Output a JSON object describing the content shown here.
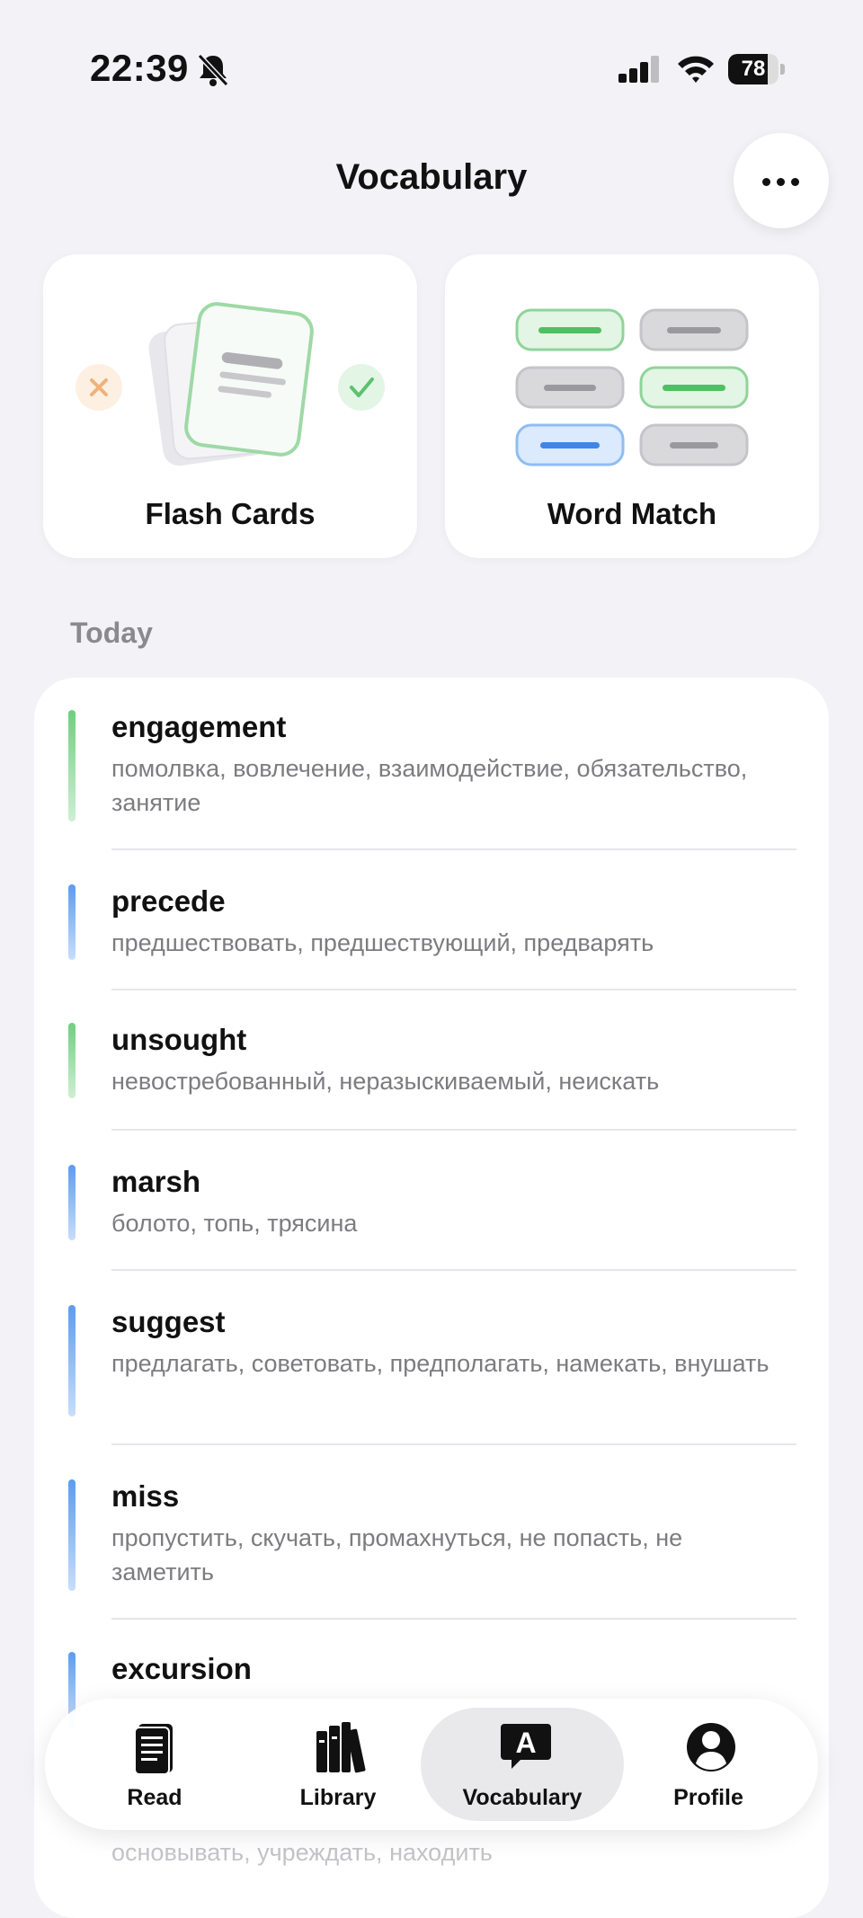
{
  "status_bar": {
    "time": "22:39",
    "battery": "78",
    "battery_level": 0.78
  },
  "header": {
    "title": "Vocabulary"
  },
  "modes": [
    {
      "label": "Flash Cards"
    },
    {
      "label": "Word Match"
    }
  ],
  "section": {
    "label": "Today"
  },
  "words": [
    {
      "word": "engagement",
      "translation": "помолвка, вовлечение, взаимодействие, обязательство, занятие",
      "accent": "#6fcf7f"
    },
    {
      "word": "precede",
      "translation": "предшествовать, предшествующий, предварять",
      "accent": "#5b9cf2"
    },
    {
      "word": "unsought",
      "translation": "невостребованный, неразыскиваемый, неискать",
      "accent": "#6fcf7f"
    },
    {
      "word": "marsh",
      "translation": "болото, топь, трясина",
      "accent": "#5b9cf2"
    },
    {
      "word": "suggest",
      "translation": "предлагать, советовать, предполагать, намекать, внушать",
      "accent": "#5b9cf2"
    },
    {
      "word": "miss",
      "translation": "пропустить, скучать, промахнуться, не попасть, не заметить",
      "accent": "#5b9cf2"
    },
    {
      "word": "excursion",
      "translation": "",
      "accent": "#5b9cf2"
    }
  ],
  "peek_text": "основывать, учреждать, находить",
  "tabs": [
    {
      "label": "Read"
    },
    {
      "label": "Library"
    },
    {
      "label": "Vocabulary"
    },
    {
      "label": "Profile"
    }
  ]
}
